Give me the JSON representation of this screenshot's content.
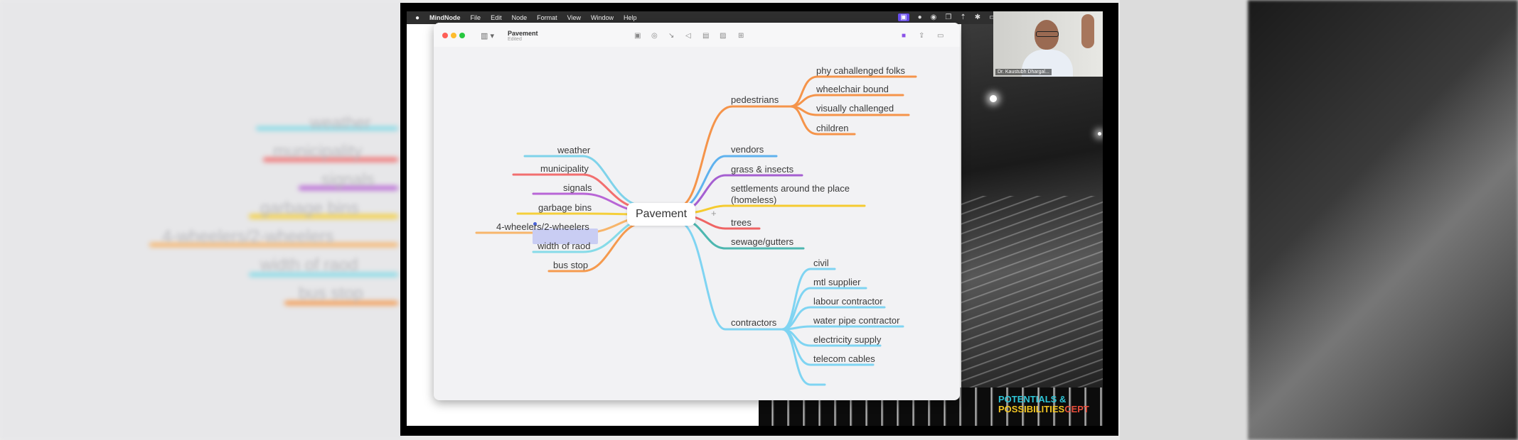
{
  "background_left": {
    "ghost_labels": [
      "weather",
      "municipality",
      "signals",
      "garbage bins",
      "4-wheelers/2-wheelers",
      "width of raod",
      "bus stop"
    ]
  },
  "menubar": {
    "apple_icon": "apple-icon",
    "items": [
      "MindNode",
      "File",
      "Edit",
      "Node",
      "Format",
      "View",
      "Window",
      "Help"
    ]
  },
  "window": {
    "title": "Pavement",
    "subtitle": "Edited"
  },
  "mindmap": {
    "root": "Pavement",
    "left_nodes": [
      "weather",
      "municipality",
      "signals",
      "garbage bins",
      "4-wheelers/2-wheelers",
      "width of raod",
      "bus stop"
    ],
    "right_nodes": {
      "pedestrians": "pedestrians",
      "pedestrian_children": [
        "phy cahallenged folks",
        "wheelchair bound",
        "visually challenged",
        "children"
      ],
      "vendors": "vendors",
      "grass": "grass & insects",
      "settlements_line1": "settlements around the place",
      "settlements_line2": "(homeless)",
      "trees": "trees",
      "sewage": "sewage/gutters",
      "contractors": "contractors",
      "contractor_children": [
        "civil",
        "mtl supplier",
        "labour contractor",
        "water pipe contractor",
        "electricity supply",
        "telecom cables"
      ]
    },
    "colors": {
      "weather": "#7fd3ea",
      "municipality": "#f26f6f",
      "signals": "#b865d6",
      "garbage": "#f5cf3b",
      "wheelers": "#f7b56b",
      "width": "#86dbe8",
      "bus": "#f59a4e",
      "pedestrians": "#f5944a",
      "vendors": "#5fb2ee",
      "grass": "#a55fd1",
      "settlements": "#f5cb2f",
      "trees": "#ef6464",
      "sewage": "#4db7b0",
      "contractors": "#7fd4f2"
    }
  },
  "webcam": {
    "name": "Dr. Kaustubh Dhargal..."
  },
  "logo": {
    "line1": "POTENTIALS &",
    "line2_a": "POSSIBILITIES",
    "line2_b": "CEPT"
  }
}
